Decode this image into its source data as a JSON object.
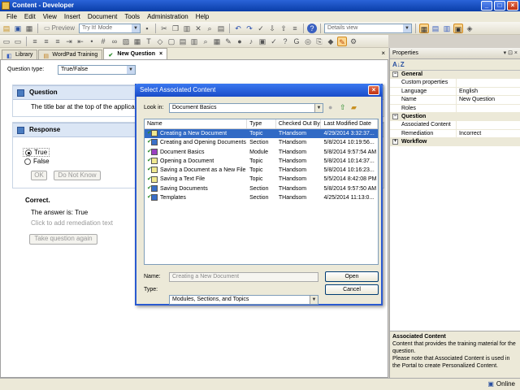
{
  "window": {
    "title": "Content - Developer"
  },
  "menu": [
    "File",
    "Edit",
    "View",
    "Insert",
    "Document",
    "Tools",
    "Administration",
    "Help"
  ],
  "toolbar": {
    "preview_label": "Preview",
    "mode_combo": "Try It! Mode",
    "view_combo": "Details view"
  },
  "tabs": [
    {
      "label": "Library",
      "active": false
    },
    {
      "label": "WordPad Training",
      "active": false
    },
    {
      "label": "New Question",
      "active": true
    }
  ],
  "editor": {
    "question_type_label": "Question type:",
    "question_type_value": "True/False",
    "question_header": "Question",
    "question_text": "The title bar at the top of the applica",
    "response_header": "Response",
    "options": [
      {
        "label": "True",
        "selected": true
      },
      {
        "label": "False",
        "selected": false
      }
    ],
    "ok_label": "OK",
    "dont_know_label": "Do Not Know",
    "correct_label": "Correct.",
    "answer_text": "The answer is: True",
    "remediation_hint": "Click to add remediation text",
    "take_again_label": "Take question again"
  },
  "properties": {
    "title": "Properties",
    "categories": [
      {
        "name": "General",
        "rows": [
          {
            "label": "Custom properties",
            "value": ""
          },
          {
            "label": "Language",
            "value": "English"
          },
          {
            "label": "Name",
            "value": "New Question"
          },
          {
            "label": "Roles",
            "value": ""
          }
        ]
      },
      {
        "name": "Question",
        "rows": [
          {
            "label": "Associated Content",
            "value": ""
          },
          {
            "label": "Remediation",
            "value": "Incorrect"
          }
        ]
      },
      {
        "name": "Workflow",
        "rows": []
      }
    ],
    "desc_title": "Associated Content",
    "desc_text": "Content that provides the training material for the question.",
    "desc_text2": "Please note that Associated Content is used in the Portal to create Personalized Content."
  },
  "status": {
    "text": "Online"
  },
  "dialog": {
    "title": "Select Associated Content",
    "look_in_label": "Look in:",
    "look_in_value": "Document Basics",
    "columns": [
      "Name",
      "Type",
      "Checked Out By",
      "Last Modified Date"
    ],
    "rows": [
      {
        "name": "Creating a New Document",
        "type": "Topic",
        "by": "THandsom",
        "date": "4/29/2014 3:32:37...",
        "selected": true
      },
      {
        "name": "Creating and Opening Documents",
        "type": "Section",
        "by": "THandsom",
        "date": "5/8/2014 10:19:56...",
        "selected": false
      },
      {
        "name": "Document Basics",
        "type": "Module",
        "by": "THandsom",
        "date": "5/8/2014 9:57:54 AM",
        "selected": false
      },
      {
        "name": "Opening a Document",
        "type": "Topic",
        "by": "THandsom",
        "date": "5/8/2014 10:14:37...",
        "selected": false
      },
      {
        "name": "Saving a Document as a New File",
        "type": "Topic",
        "by": "THandsom",
        "date": "5/8/2014 10:16:23...",
        "selected": false
      },
      {
        "name": "Saving a Text File",
        "type": "Topic",
        "by": "THandsom",
        "date": "5/5/2014 8:42:08 PM",
        "selected": false
      },
      {
        "name": "Saving Documents",
        "type": "Section",
        "by": "THandsom",
        "date": "5/8/2014 9:57:50 AM",
        "selected": false
      },
      {
        "name": "Templates",
        "type": "Section",
        "by": "THandsom",
        "date": "4/25/2014 11:13:0...",
        "selected": false
      }
    ],
    "name_label": "Name:",
    "name_value": "Creating a New Document",
    "type_label": "Type:",
    "type_value": "Modules, Sections, and Topics",
    "open_label": "Open",
    "cancel_label": "Cancel"
  }
}
